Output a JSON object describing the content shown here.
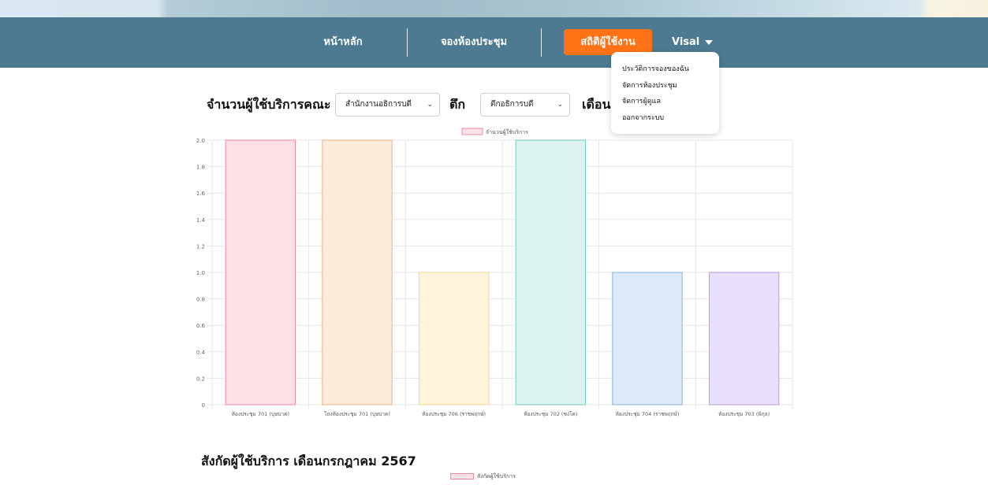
{
  "nav": {
    "home_label": "หน้าหลัก",
    "booking_label": "จองห้องประชุม",
    "stats_label": "สถิติผู้ใช้งาน",
    "user_label": "Visal",
    "accent_color": "#ff7316",
    "bar_color": "#4d7a91"
  },
  "user_menu": {
    "items": [
      {
        "label": "ประวัติการจองของฉัน"
      },
      {
        "label": "จัดการห้องประชุม"
      },
      {
        "label": "จัดการผู้ดูแล"
      },
      {
        "label": "ออกจากระบบ"
      }
    ]
  },
  "filters": {
    "count_label": "จำนวนผู้ใช้บริการคณะ",
    "office_value": "สำนักงานอธิการบดี",
    "building_label": "ตึก",
    "building_value": "ตึกอธิการบดี",
    "month_label": "เดือน"
  },
  "chart_data": {
    "type": "bar",
    "legend": "จำนวนผู้ใช้บริการ",
    "categories": [
      "ห้องประชุม 701 (บุษบาค)",
      "โถงห้องประชุม 701 (บุษบาค)",
      "ห้องประชุม 706 (ราชพฤกษ์)",
      "ห้องประชุม 702 (ชงโค)",
      "ห้องประชุม 704 (ราชพฤกษ์)",
      "ห้องประชุม 703 (พิกุล)"
    ],
    "values": [
      2,
      2,
      1,
      2,
      1,
      1
    ],
    "ylim": [
      0,
      2
    ],
    "yticks": [
      "0",
      "0.2",
      "0.4",
      "0.6",
      "0.8",
      "1.0",
      "1.2",
      "1.4",
      "1.6",
      "1.8",
      "2.0"
    ],
    "grid": true,
    "legend_position": "top",
    "fill_colors": [
      "#fde1e6",
      "#fdebdc",
      "#fef4dc",
      "#dbf2ef",
      "#dbe9f8",
      "#ebe0fb"
    ],
    "stroke_colors": [
      "#f08aa0",
      "#f6b07a",
      "#f9d48a",
      "#72c8c2",
      "#7fb4e6",
      "#b59af0"
    ]
  },
  "section2": {
    "title": "สังกัดผู้ใช้บริการ เดือนกรกฎาคม 2567",
    "legend": "สังกัดผู้ใช้บริการ"
  }
}
